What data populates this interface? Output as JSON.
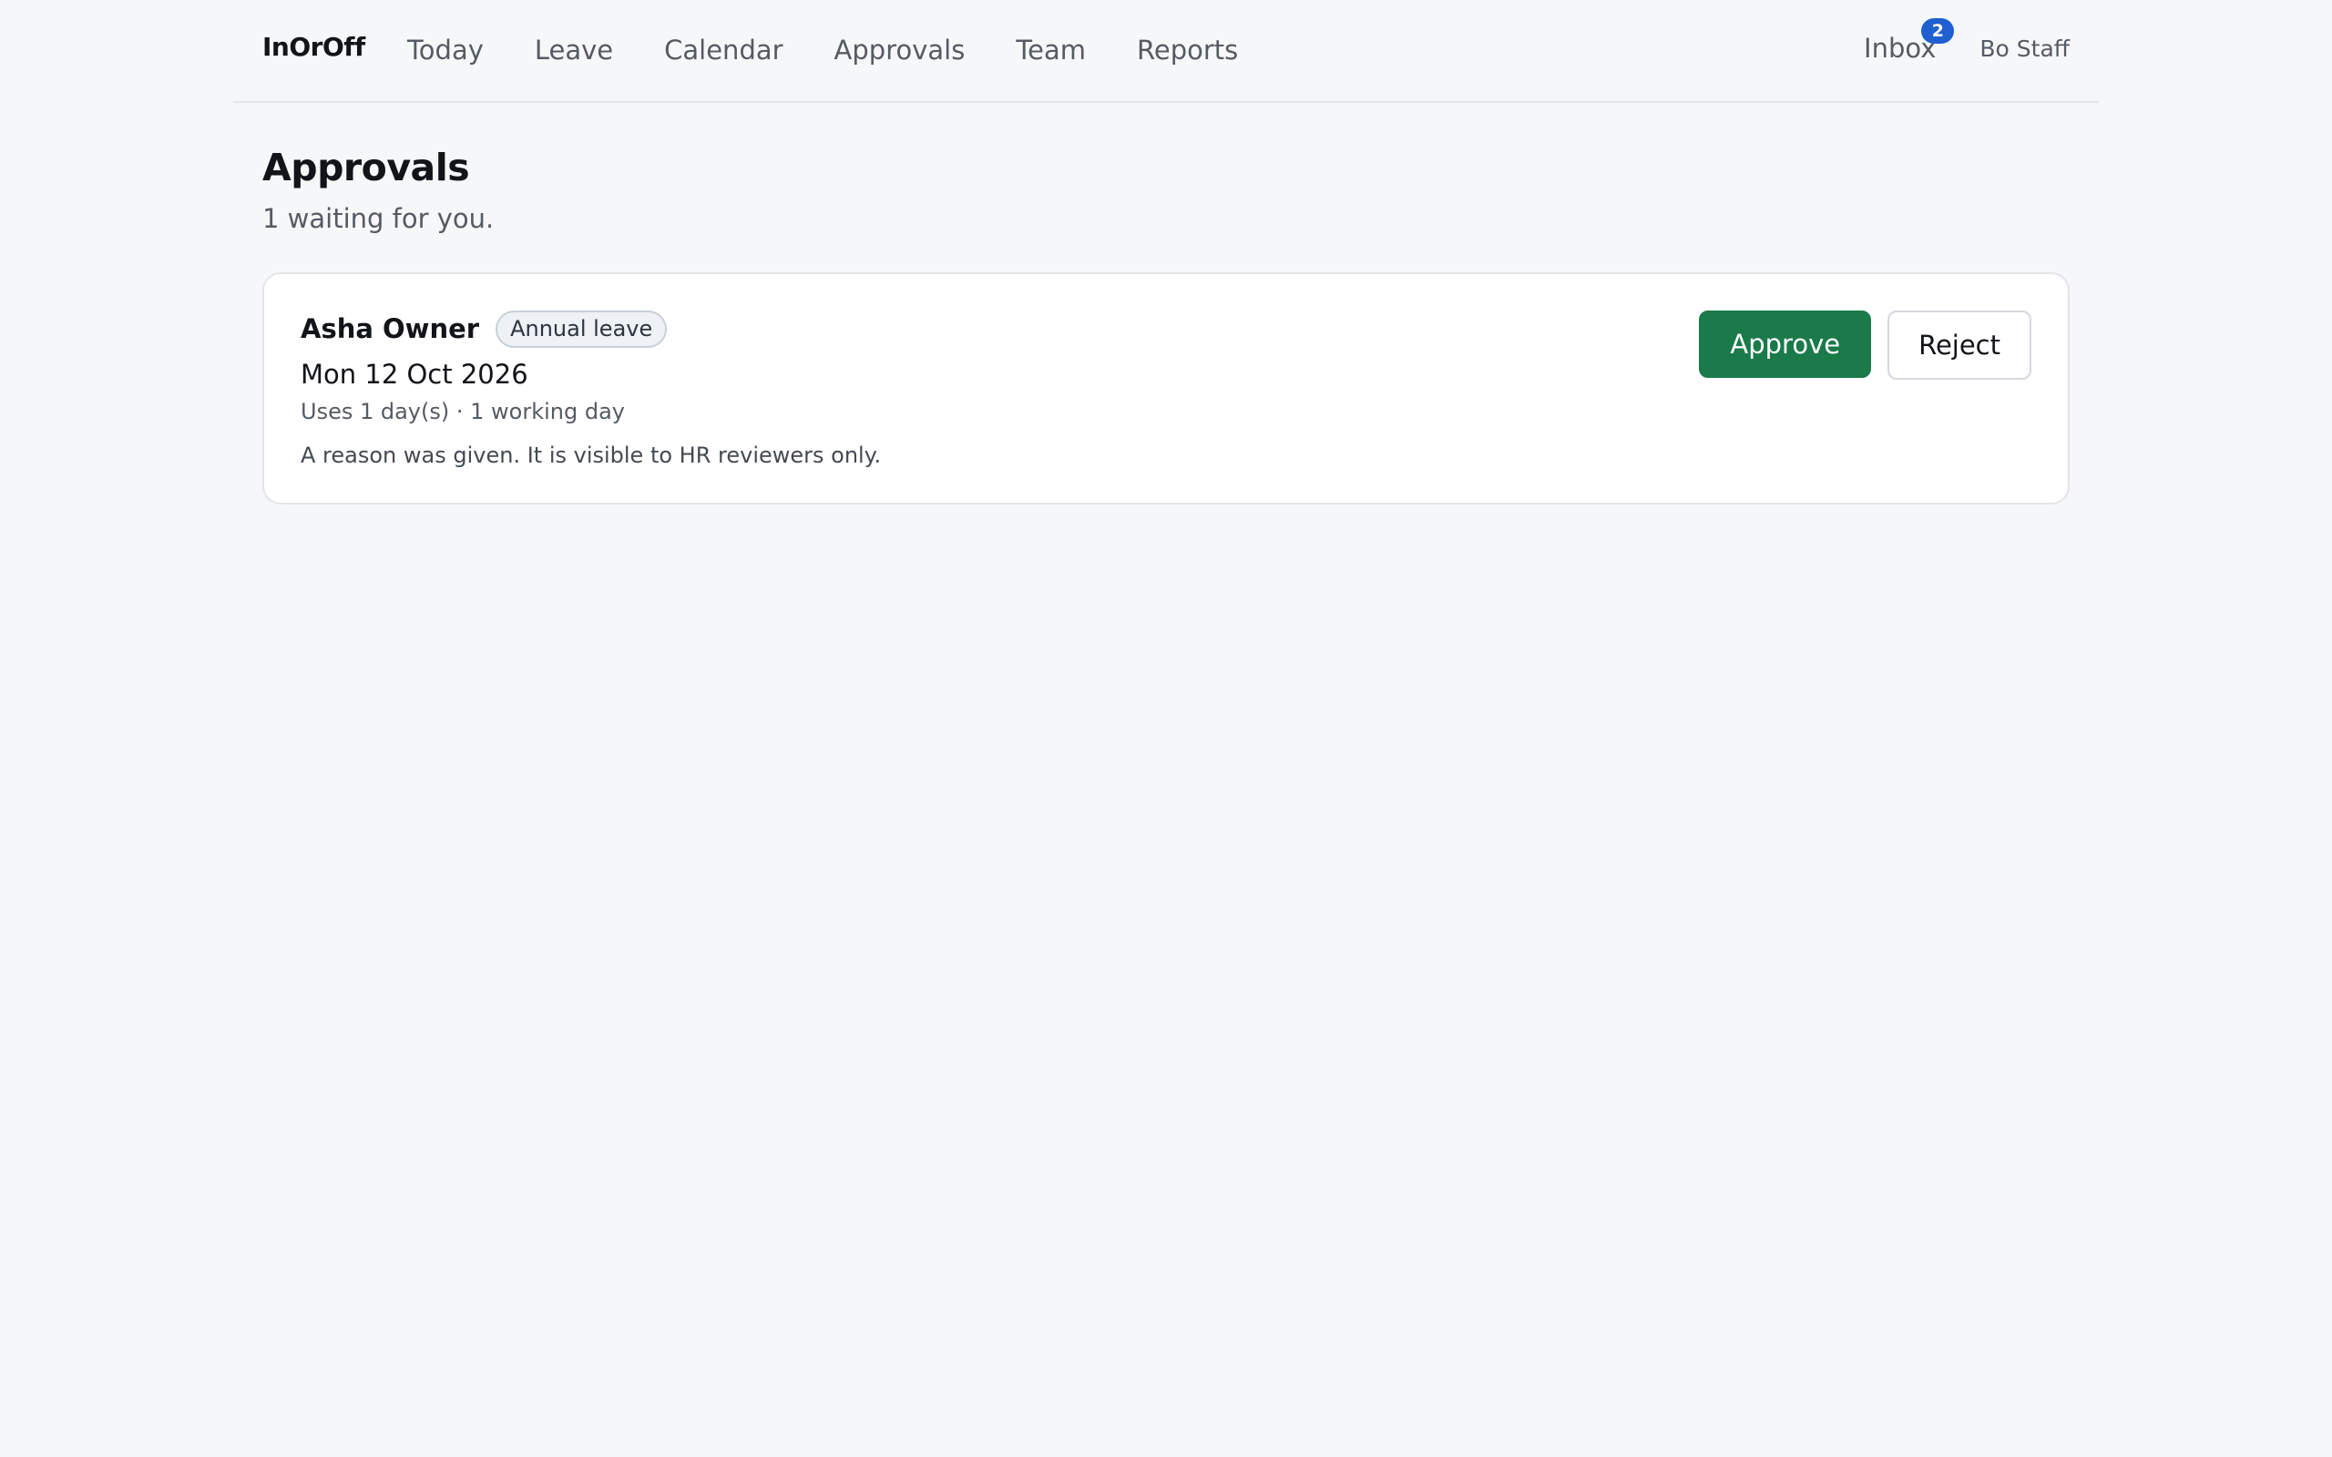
{
  "header": {
    "brand": "InOrOff",
    "nav": [
      "Today",
      "Leave",
      "Calendar",
      "Approvals",
      "Team",
      "Reports"
    ],
    "inbox_label": "Inbox",
    "inbox_count": "2",
    "user_name": "Bo Staff"
  },
  "page": {
    "title": "Approvals",
    "subtitle": "1 waiting for you."
  },
  "requests": [
    {
      "employee": "Asha Owner",
      "leave_type": "Annual leave",
      "date": "Mon 12 Oct 2026",
      "usage": "Uses 1 day(s) · 1 working day",
      "reason_note": "A reason was given. It is visible to HR reviewers only.",
      "approve_label": "Approve",
      "reject_label": "Reject"
    }
  ],
  "colors": {
    "accent_approve": "#1a7a4a",
    "badge": "#1f5fcf",
    "background": "#f6f7f9"
  }
}
